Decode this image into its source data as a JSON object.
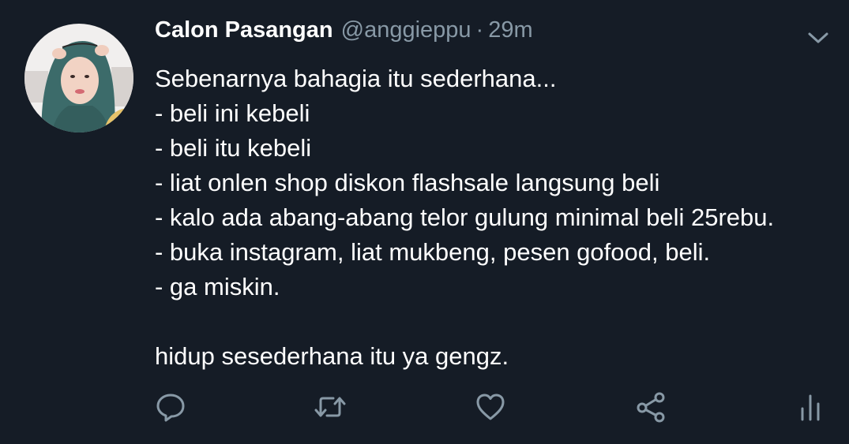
{
  "tweet": {
    "author": {
      "display_name": "Calon Pasangan",
      "handle": "@anggieppu",
      "separator": "·",
      "time": "29m"
    },
    "text_lines": [
      "Sebenarnya bahagia itu sederhana...",
      "- beli ini kebeli",
      "- beli itu kebeli",
      "- liat onlen shop diskon flashsale langsung beli",
      "- kalo ada abang-abang telor gulung minimal beli 25rebu.",
      "- buka instagram, liat mukbeng, pesen gofood, beli.",
      "- ga miskin.",
      "",
      "hidup sesederhana itu ya gengz."
    ],
    "actions": [
      {
        "name": "reply-icon"
      },
      {
        "name": "retweet-icon"
      },
      {
        "name": "like-icon"
      },
      {
        "name": "share-icon"
      },
      {
        "name": "analytics-icon"
      }
    ]
  },
  "colors": {
    "background": "#151c26",
    "text_primary": "#ffffff",
    "text_secondary": "#8899a6",
    "icon": "#8899a6"
  }
}
